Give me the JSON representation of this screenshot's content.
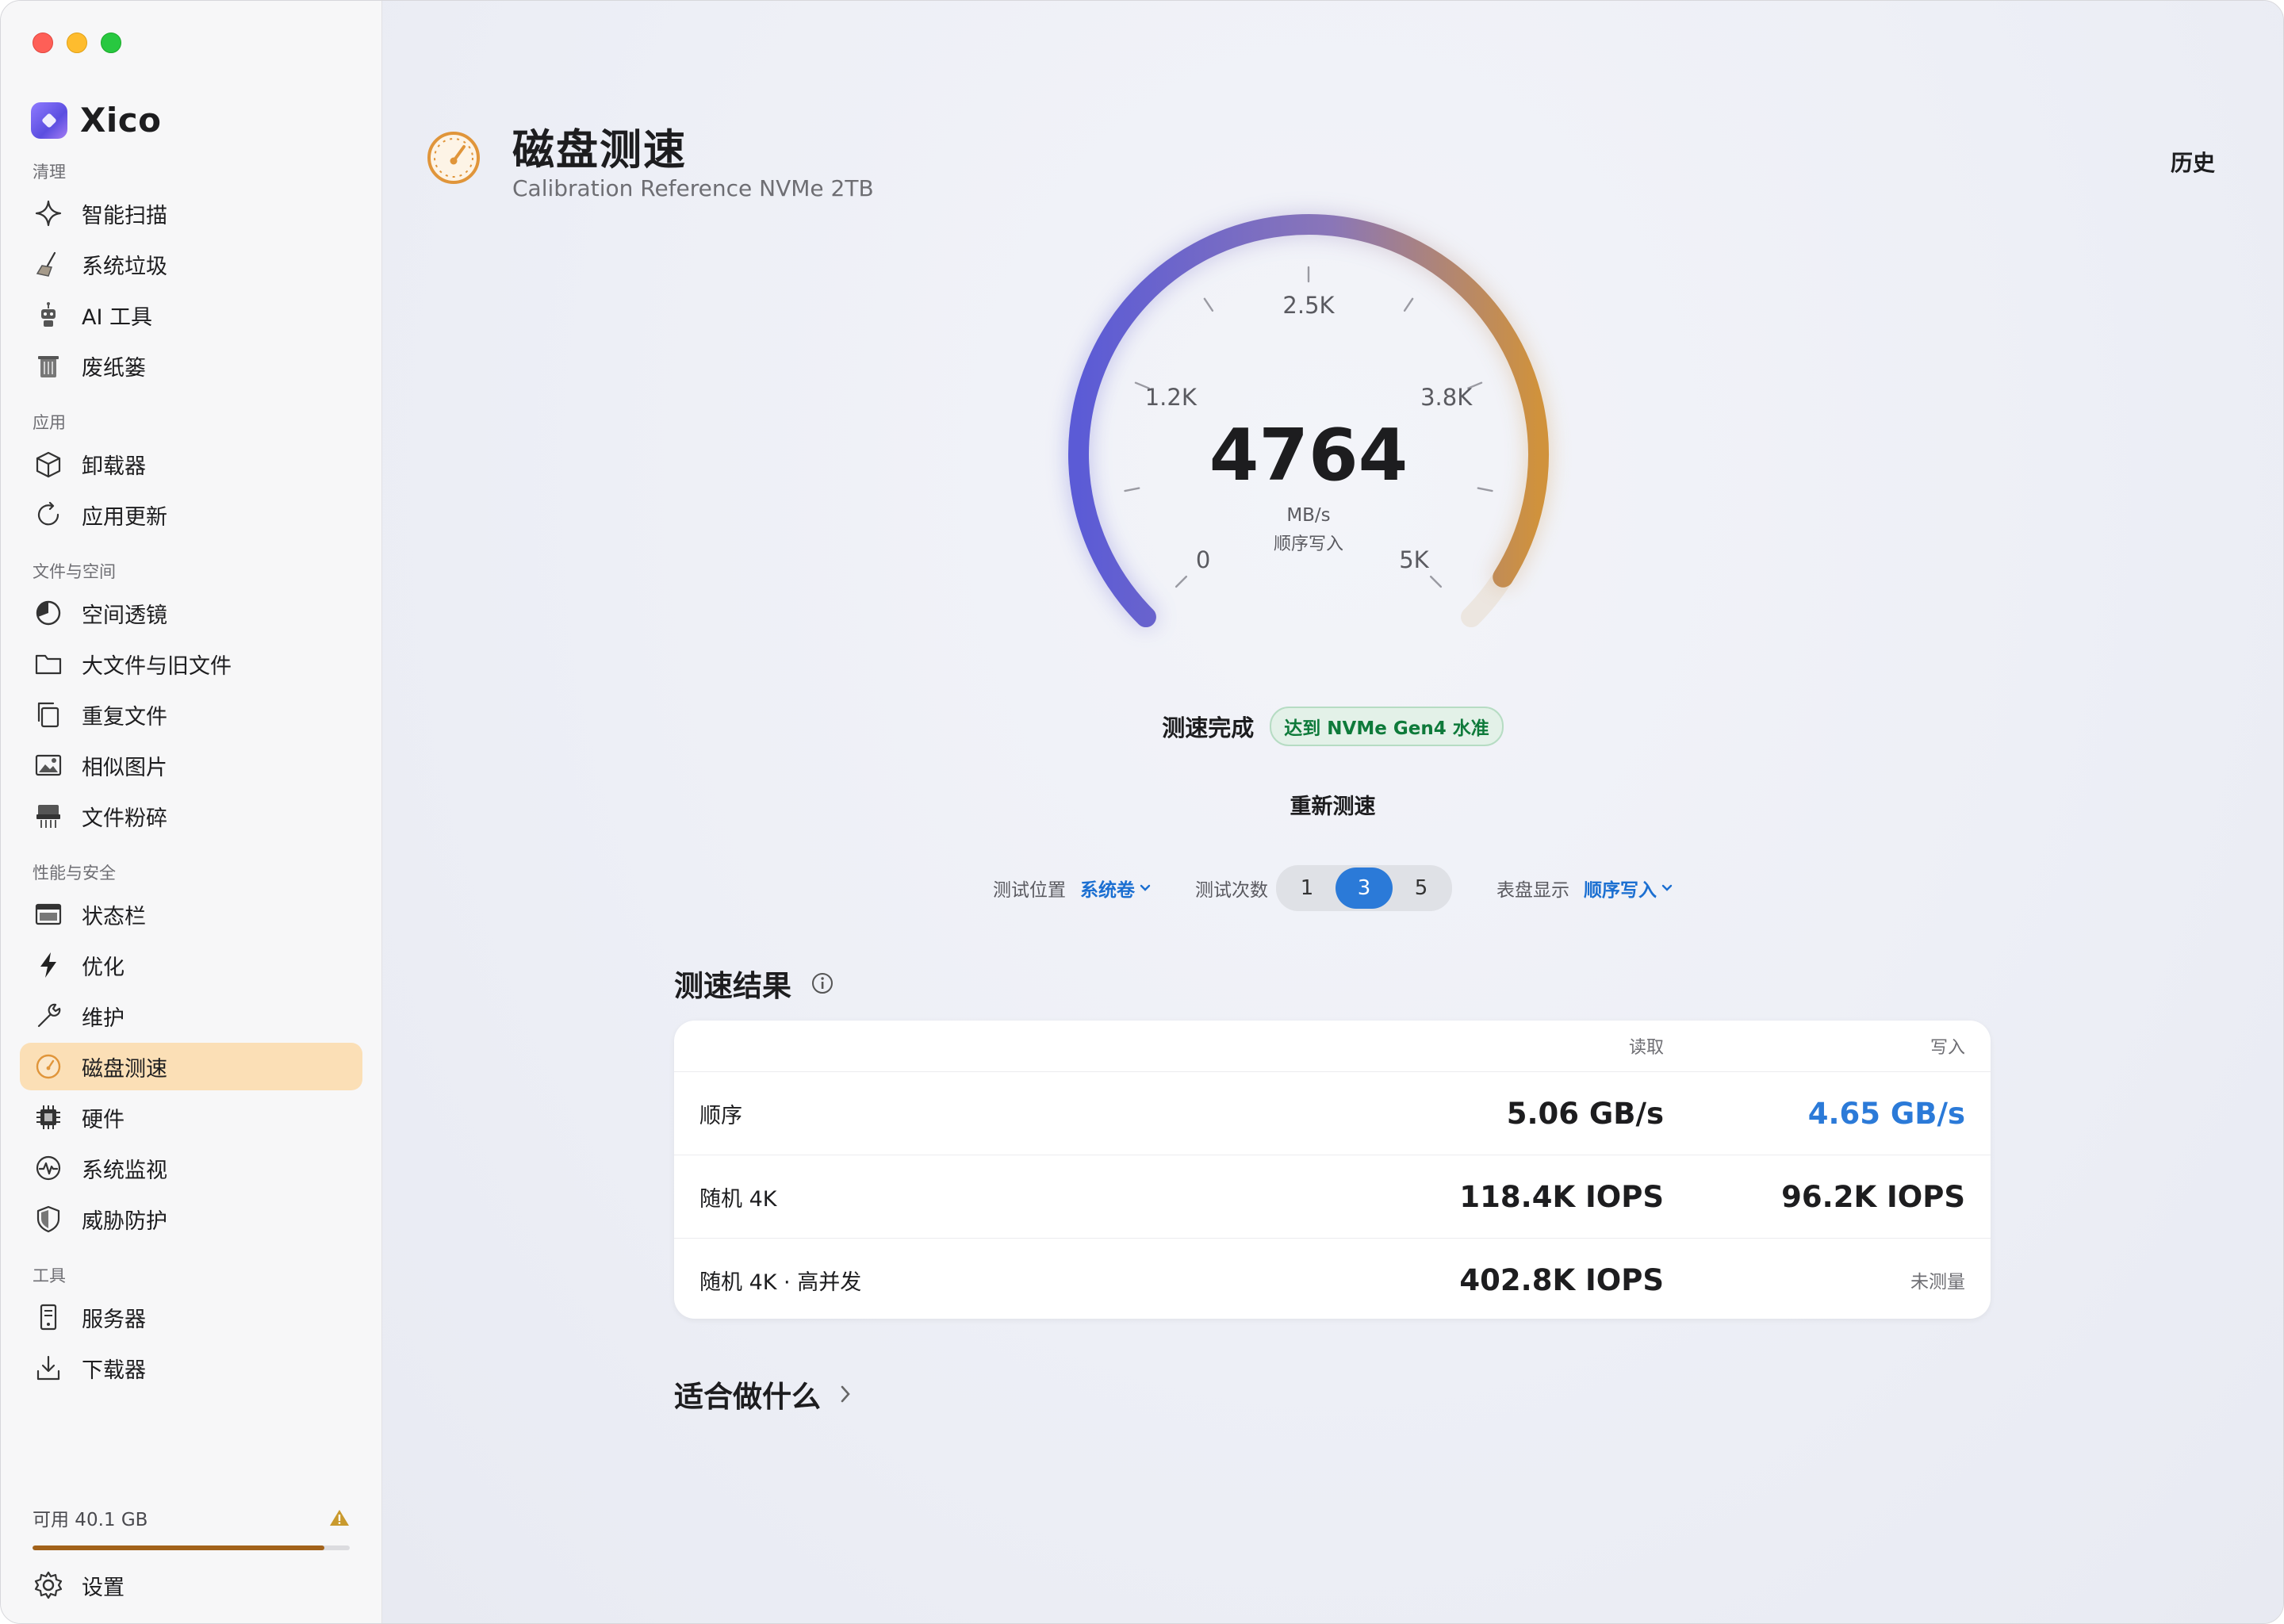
{
  "app": {
    "name": "Xico"
  },
  "sidebar": {
    "sections": [
      {
        "title": "清理",
        "items": [
          {
            "label": "智能扫描",
            "icon": "sparkle-icon"
          },
          {
            "label": "系统垃圾",
            "icon": "broom-icon"
          },
          {
            "label": "AI 工具",
            "icon": "robot-icon"
          },
          {
            "label": "废纸篓",
            "icon": "trash-icon"
          }
        ]
      },
      {
        "title": "应用",
        "items": [
          {
            "label": "卸载器",
            "icon": "box-icon"
          },
          {
            "label": "应用更新",
            "icon": "refresh-icon"
          }
        ]
      },
      {
        "title": "文件与空间",
        "items": [
          {
            "label": "空间透镜",
            "icon": "pie-chart-icon"
          },
          {
            "label": "大文件与旧文件",
            "icon": "folder-icon"
          },
          {
            "label": "重复文件",
            "icon": "duplicate-icon"
          },
          {
            "label": "相似图片",
            "icon": "image-icon"
          },
          {
            "label": "文件粉碎",
            "icon": "shredder-icon"
          }
        ]
      },
      {
        "title": "性能与安全",
        "items": [
          {
            "label": "状态栏",
            "icon": "menubar-icon"
          },
          {
            "label": "优化",
            "icon": "bolt-icon"
          },
          {
            "label": "维护",
            "icon": "wrench-icon"
          },
          {
            "label": "磁盘测速",
            "icon": "speedometer-icon",
            "active": true
          },
          {
            "label": "硬件",
            "icon": "chip-icon"
          },
          {
            "label": "系统监视",
            "icon": "pulse-icon"
          },
          {
            "label": "威胁防护",
            "icon": "shield-icon"
          }
        ]
      },
      {
        "title": "工具",
        "items": [
          {
            "label": "服务器",
            "icon": "server-icon"
          },
          {
            "label": "下载器",
            "icon": "download-icon"
          }
        ]
      }
    ],
    "storage": {
      "label": "可用 40.1 GB",
      "used_fraction": 0.92,
      "warning_icon": "warning-icon"
    },
    "settings": {
      "label": "设置",
      "icon": "gear-icon"
    }
  },
  "header": {
    "icon": "speedometer-icon",
    "title": "磁盘测速",
    "subtitle": "Calibration Reference NVMe 2TB",
    "history_label": "历史"
  },
  "gauge": {
    "value": "4764",
    "numeric_value": 4764,
    "max": 5000,
    "unit": "MB/s",
    "mode": "顺序写入",
    "tick_labels": [
      "0",
      "1.2K",
      "2.5K",
      "3.8K",
      "5K"
    ],
    "colors": {
      "start": "#5b5bd6",
      "end": "#d0923c",
      "track": "#ece6e0"
    }
  },
  "status": {
    "text": "测速完成",
    "badge": "达到 NVMe Gen4 水准"
  },
  "retest_label": "重新测速",
  "controls": {
    "location_label": "测试位置",
    "location_value": "系统卷",
    "runs_label": "测试次数",
    "runs_options": [
      "1",
      "3",
      "5"
    ],
    "runs_selected": "3",
    "dial_label": "表盘显示",
    "dial_value": "顺序写入"
  },
  "results": {
    "title": "测速结果",
    "columns": [
      "读取",
      "写入"
    ],
    "rows": [
      {
        "name": "顺序",
        "read": "5.06 GB/s",
        "write": "4.65 GB/s",
        "write_highlight": true
      },
      {
        "name": "随机 4K",
        "read": "118.4K IOPS",
        "write": "96.2K IOPS"
      },
      {
        "name": "随机 4K · 高并发",
        "read": "402.8K IOPS",
        "write": "未测量",
        "write_na": true
      }
    ]
  },
  "fit_section": {
    "title": "适合做什么"
  },
  "accent": "#2b7ad8"
}
